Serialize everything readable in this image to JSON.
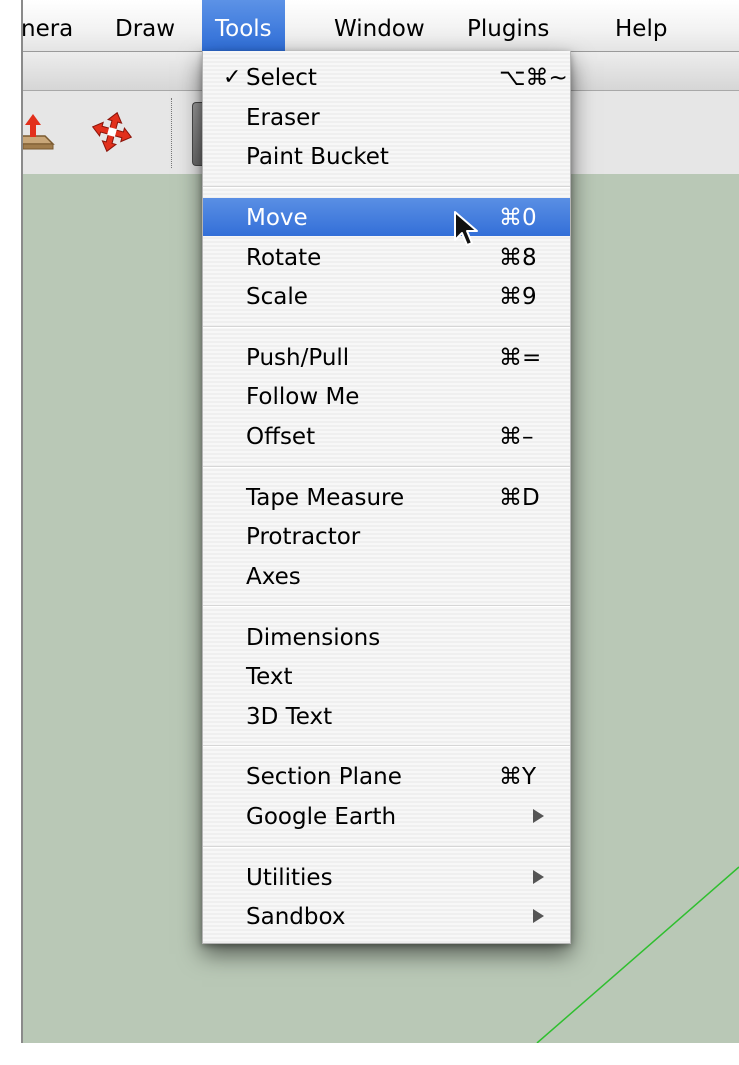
{
  "menubar": {
    "items": [
      {
        "label": "nera"
      },
      {
        "label": "Draw"
      },
      {
        "label": "Tools"
      },
      {
        "label": "Window"
      },
      {
        "label": "Plugins"
      },
      {
        "label": "Help"
      }
    ],
    "active_item": "Tools"
  },
  "toolbar": {
    "icons": [
      "push-pull-icon",
      "move-icon"
    ]
  },
  "tools_menu": {
    "groups": [
      [
        {
          "label": "Select",
          "shortcut": "⌥⌘~",
          "checked": true
        },
        {
          "label": "Eraser",
          "shortcut": ""
        },
        {
          "label": "Paint Bucket",
          "shortcut": ""
        }
      ],
      [
        {
          "label": "Move",
          "shortcut": "⌘0",
          "highlighted": true
        },
        {
          "label": "Rotate",
          "shortcut": "⌘8"
        },
        {
          "label": "Scale",
          "shortcut": "⌘9"
        }
      ],
      [
        {
          "label": "Push/Pull",
          "shortcut": "⌘="
        },
        {
          "label": "Follow Me",
          "shortcut": ""
        },
        {
          "label": "Offset",
          "shortcut": "⌘–"
        }
      ],
      [
        {
          "label": "Tape Measure",
          "shortcut": "⌘D"
        },
        {
          "label": "Protractor",
          "shortcut": ""
        },
        {
          "label": "Axes",
          "shortcut": ""
        }
      ],
      [
        {
          "label": "Dimensions",
          "shortcut": ""
        },
        {
          "label": "Text",
          "shortcut": ""
        },
        {
          "label": "3D Text",
          "shortcut": ""
        }
      ],
      [
        {
          "label": "Section Plane",
          "shortcut": "⌘Y"
        },
        {
          "label": "Google Earth",
          "shortcut": "",
          "submenu": true
        }
      ],
      [
        {
          "label": "Utilities",
          "shortcut": "",
          "submenu": true
        },
        {
          "label": "Sandbox",
          "shortcut": "",
          "submenu": true
        }
      ]
    ],
    "check_glyph": "✓"
  },
  "colors": {
    "menu_highlight": "#3d78dc",
    "viewport_background": "#b9c8b6",
    "axis_green": "#2fbf2f",
    "toolbar_icon_red": "#e2301c"
  }
}
